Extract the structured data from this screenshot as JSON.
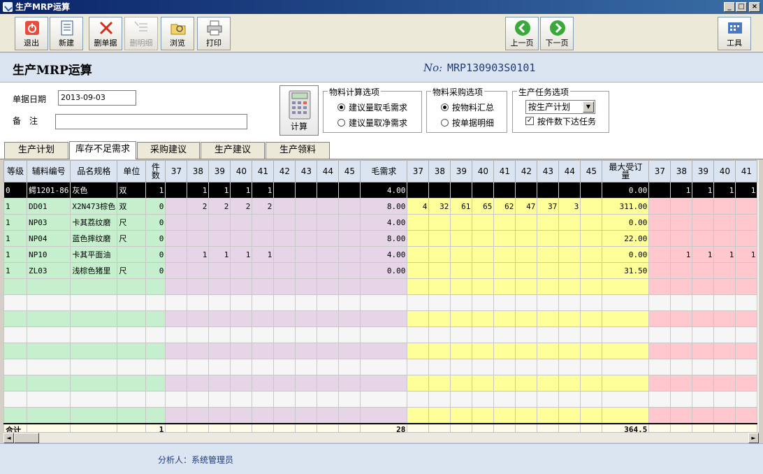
{
  "window": {
    "title": "生产MRP运算",
    "min": "_",
    "max": "□",
    "close": "×"
  },
  "toolbar": {
    "exit": "退出",
    "new": "新建",
    "delete_doc": "删单据",
    "delete_detail": "删明细",
    "browse": "浏览",
    "print": "打印",
    "prev": "上一页",
    "next": "下一页",
    "tools": "工具"
  },
  "header": {
    "title": "生产MRP运算",
    "no_label": "No:",
    "no_value": "MRP130903S0101"
  },
  "form": {
    "date_label": "单据日期",
    "date_value": "2013-09-03",
    "remark_label": "备　注",
    "remark_value": "",
    "calc_label": "计算",
    "group1": {
      "title": "物料计算选项",
      "opt1": "建议量取毛需求",
      "opt2": "建议量取净需求",
      "selected": 1
    },
    "group2": {
      "title": "物料采购选项",
      "opt1": "按物料汇总",
      "opt2": "按单据明细",
      "selected": 1
    },
    "group3": {
      "title": "生产任务选项",
      "select_value": "按生产计划",
      "check_label": "按件数下达任务",
      "checked": true
    }
  },
  "tabs": [
    {
      "label": "生产计划",
      "active": false
    },
    {
      "label": "库存不足需求",
      "active": true
    },
    {
      "label": "采购建议",
      "active": false
    },
    {
      "label": "生产建议",
      "active": false
    },
    {
      "label": "生产领料",
      "active": false
    }
  ],
  "grid": {
    "headers": [
      "等级",
      "辅料编号",
      "品名规格",
      "单位",
      "件\n数",
      "37",
      "38",
      "39",
      "40",
      "41",
      "42",
      "43",
      "44",
      "45",
      "毛需求",
      "37",
      "38",
      "39",
      "40",
      "41",
      "42",
      "43",
      "44",
      "45",
      "最大受订\n量",
      "37",
      "38",
      "39",
      "40",
      "41"
    ],
    "rows": [
      [
        "0",
        "鳄1201-86",
        "灰色",
        "双",
        "1",
        "",
        "1",
        "1",
        "1",
        "1",
        "",
        "",
        "",
        "",
        "4.00",
        "",
        "",
        "",
        "",
        "",
        "",
        "",
        "",
        "",
        "0.00",
        "",
        "1",
        "1",
        "1",
        "1"
      ],
      [
        "1",
        "DD01",
        "X2N473棕色",
        "双",
        "0",
        "",
        "2",
        "2",
        "2",
        "2",
        "",
        "",
        "",
        "",
        "8.00",
        "4",
        "32",
        "61",
        "65",
        "62",
        "47",
        "37",
        "3",
        "",
        "311.00",
        "",
        "",
        "",
        "",
        ""
      ],
      [
        "1",
        "NP03",
        "卡其荔纹磨",
        "尺",
        "0",
        "",
        "",
        "",
        "",
        "",
        "",
        "",
        "",
        "",
        "4.00",
        "",
        "",
        "",
        "",
        "",
        "",
        "",
        "",
        "",
        "0.00",
        "",
        "",
        "",
        "",
        ""
      ],
      [
        "1",
        "NP04",
        "蓝色摔纹磨",
        "尺",
        "0",
        "",
        "",
        "",
        "",
        "",
        "",
        "",
        "",
        "",
        "8.00",
        "",
        "",
        "",
        "",
        "",
        "",
        "",
        "",
        "",
        "22.00",
        "",
        "",
        "",
        "",
        ""
      ],
      [
        "1",
        "NP10",
        "卡其平面油",
        "",
        "0",
        "",
        "1",
        "1",
        "1",
        "1",
        "",
        "",
        "",
        "",
        "4.00",
        "",
        "",
        "",
        "",
        "",
        "",
        "",
        "",
        "",
        "0.00",
        "",
        "1",
        "1",
        "1",
        "1"
      ],
      [
        "1",
        "ZL03",
        "浅棕色猪里",
        "尺",
        "0",
        "",
        "",
        "",
        "",
        "",
        "",
        "",
        "",
        "",
        "0.00",
        "",
        "",
        "",
        "",
        "",
        "",
        "",
        "",
        "",
        "31.50",
        "",
        "",
        "",
        "",
        ""
      ]
    ],
    "empty_rows": 9,
    "total": {
      "label": "合计",
      "qty": "1",
      "gross": "28",
      "max_order": "364.5"
    }
  },
  "footer": {
    "analyst_label": "分析人：",
    "analyst": "系统管理员"
  },
  "colors": {
    "green": "#c6efce",
    "pink": "#e6d5e6",
    "yellow": "#ffff99",
    "rose": "#ffc7ce",
    "header": "#dbe5f1"
  }
}
